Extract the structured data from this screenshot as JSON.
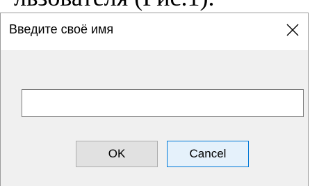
{
  "background": {
    "text": "льзователя (Рис.1)."
  },
  "dialog": {
    "title": "Введите своё имя",
    "close_icon": "close-icon",
    "input": {
      "value": "",
      "placeholder": ""
    },
    "buttons": {
      "ok_label": "OK",
      "cancel_label": "Cancel"
    }
  },
  "colors": {
    "dialog_bg": "#f0f0f0",
    "titlebar_bg": "#ffffff",
    "ok_bg": "#e1e1e1",
    "cancel_bg": "#e5f1fb",
    "cancel_border": "#0078d7"
  }
}
